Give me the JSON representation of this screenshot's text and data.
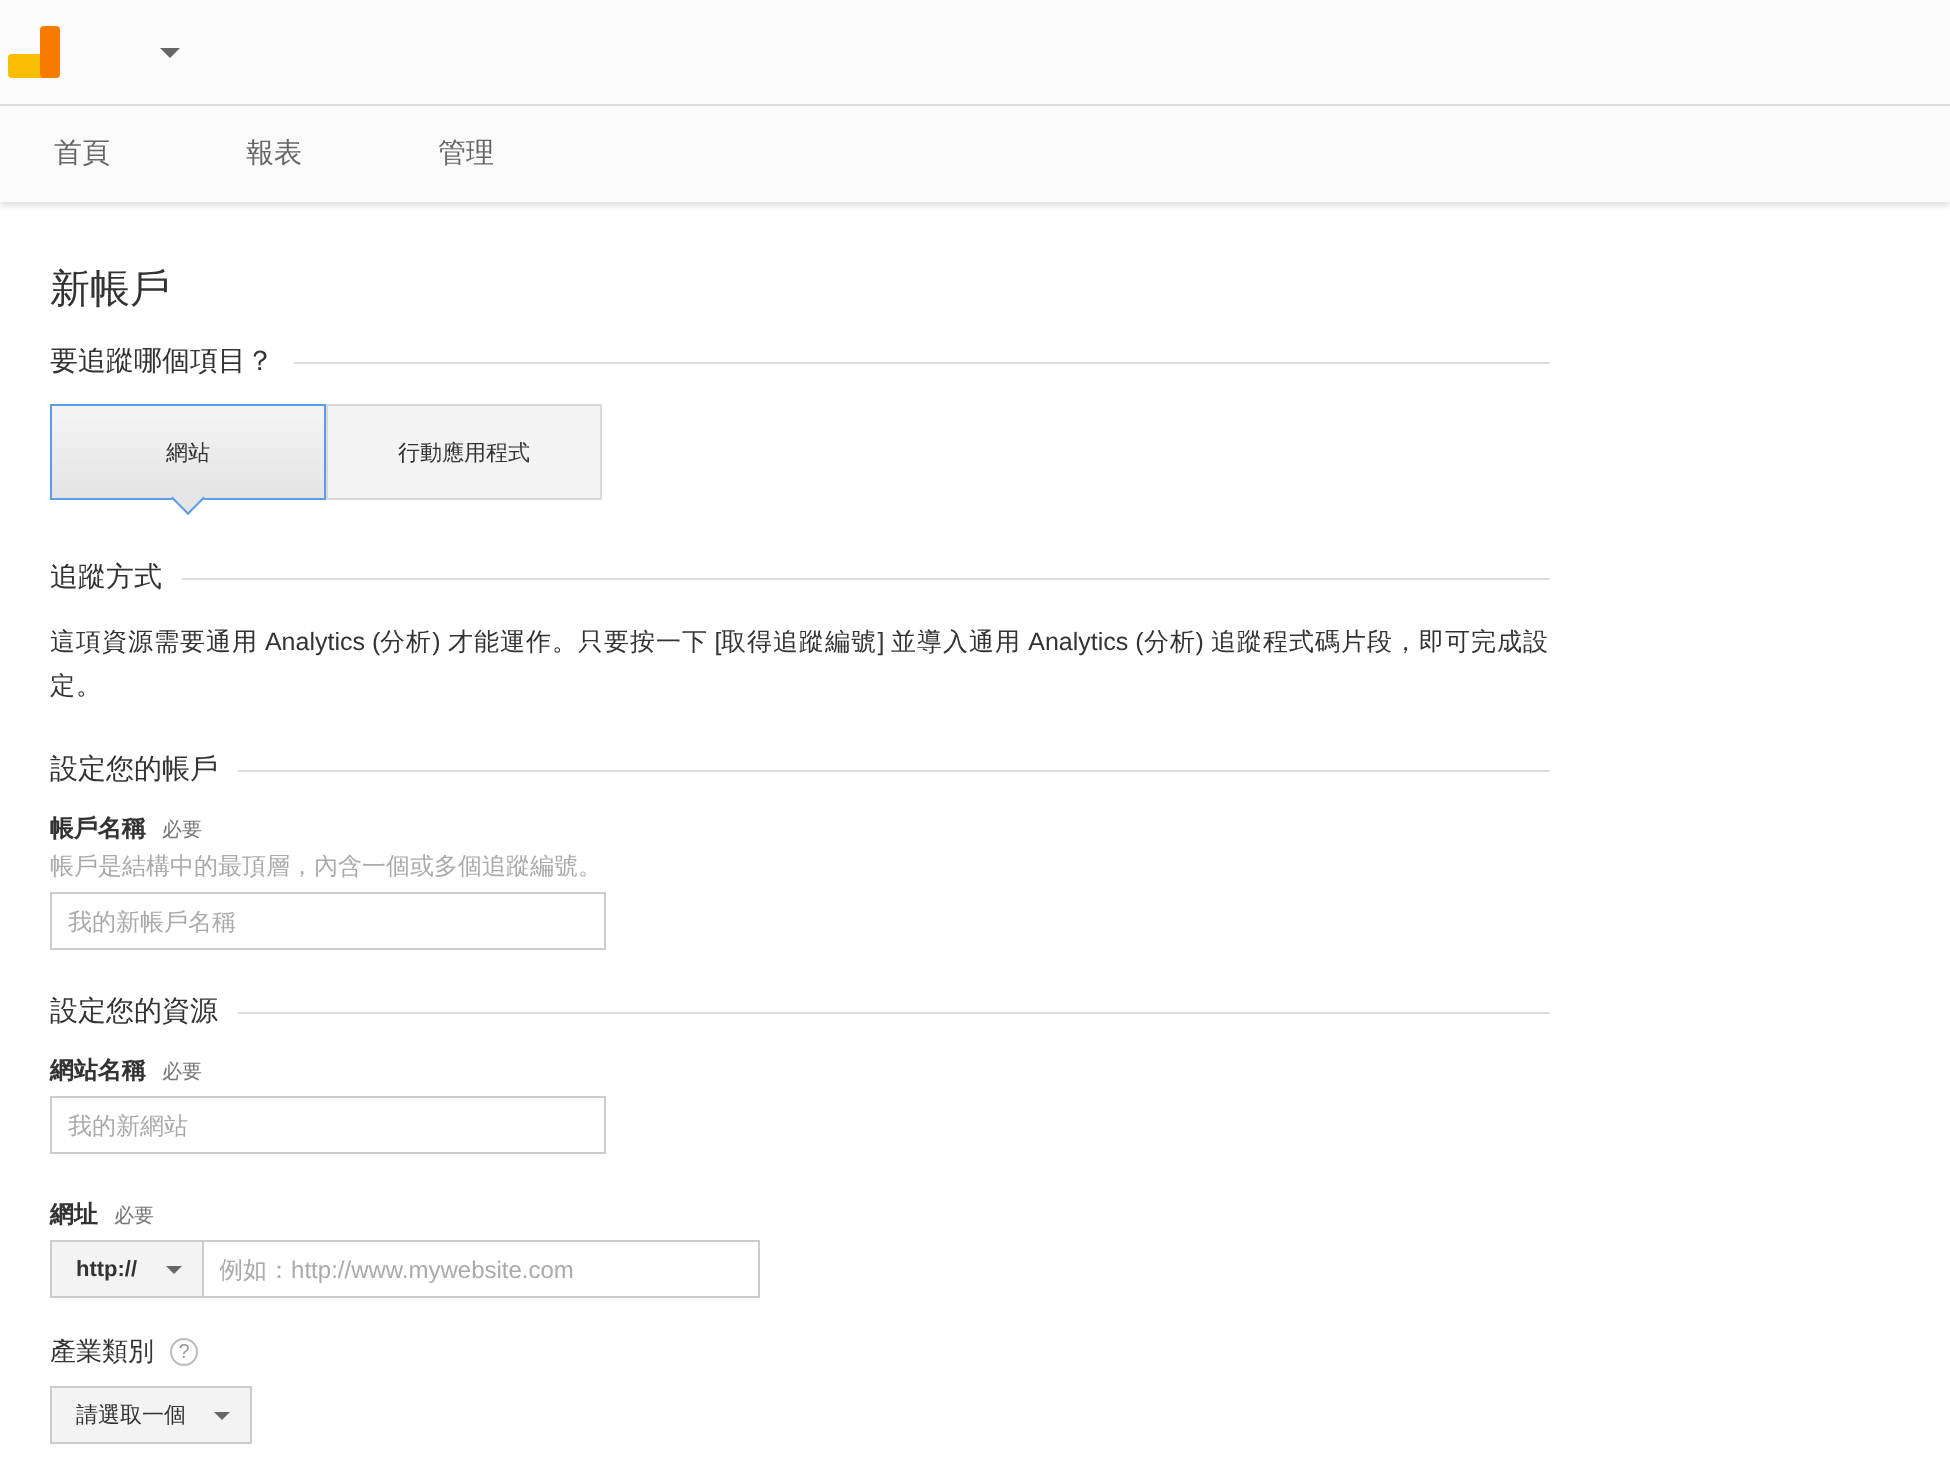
{
  "nav": [
    {
      "label": "首頁",
      "selected": false
    },
    {
      "label": "報表",
      "selected": false
    },
    {
      "label": "管理",
      "selected": false
    }
  ],
  "title": "新帳戶",
  "tracking_target": {
    "heading": "要追蹤哪個項目？",
    "options": [
      {
        "label": "網站",
        "selected": true
      },
      {
        "label": "行動應用程式",
        "selected": false
      }
    ]
  },
  "tracking_method": {
    "heading": "追蹤方式",
    "text": "這項資源需要通用 Analytics (分析) 才能運作。只要按一下 [取得追蹤編號] 並導入通用 Analytics (分析) 追蹤程式碼片段，即可完成設定。"
  },
  "account": {
    "heading": "設定您的帳戶",
    "fields": [
      {
        "label": "帳戶名稱",
        "required": "必要",
        "hint": "帳戶是結構中的最頂層，內含一個或多個追蹤編號。",
        "placeholder": "我的新帳戶名稱"
      }
    ]
  },
  "property": {
    "heading": "設定您的資源",
    "site_name": {
      "label": "網站名稱",
      "required": "必要",
      "placeholder": "我的新網站"
    },
    "url": {
      "label": "網址",
      "required": "必要",
      "protocol": "http://",
      "placeholder": "例如：http://www.mywebsite.com"
    },
    "industry": {
      "label": "產業類別",
      "help": "?",
      "select": "請選取一個"
    }
  }
}
